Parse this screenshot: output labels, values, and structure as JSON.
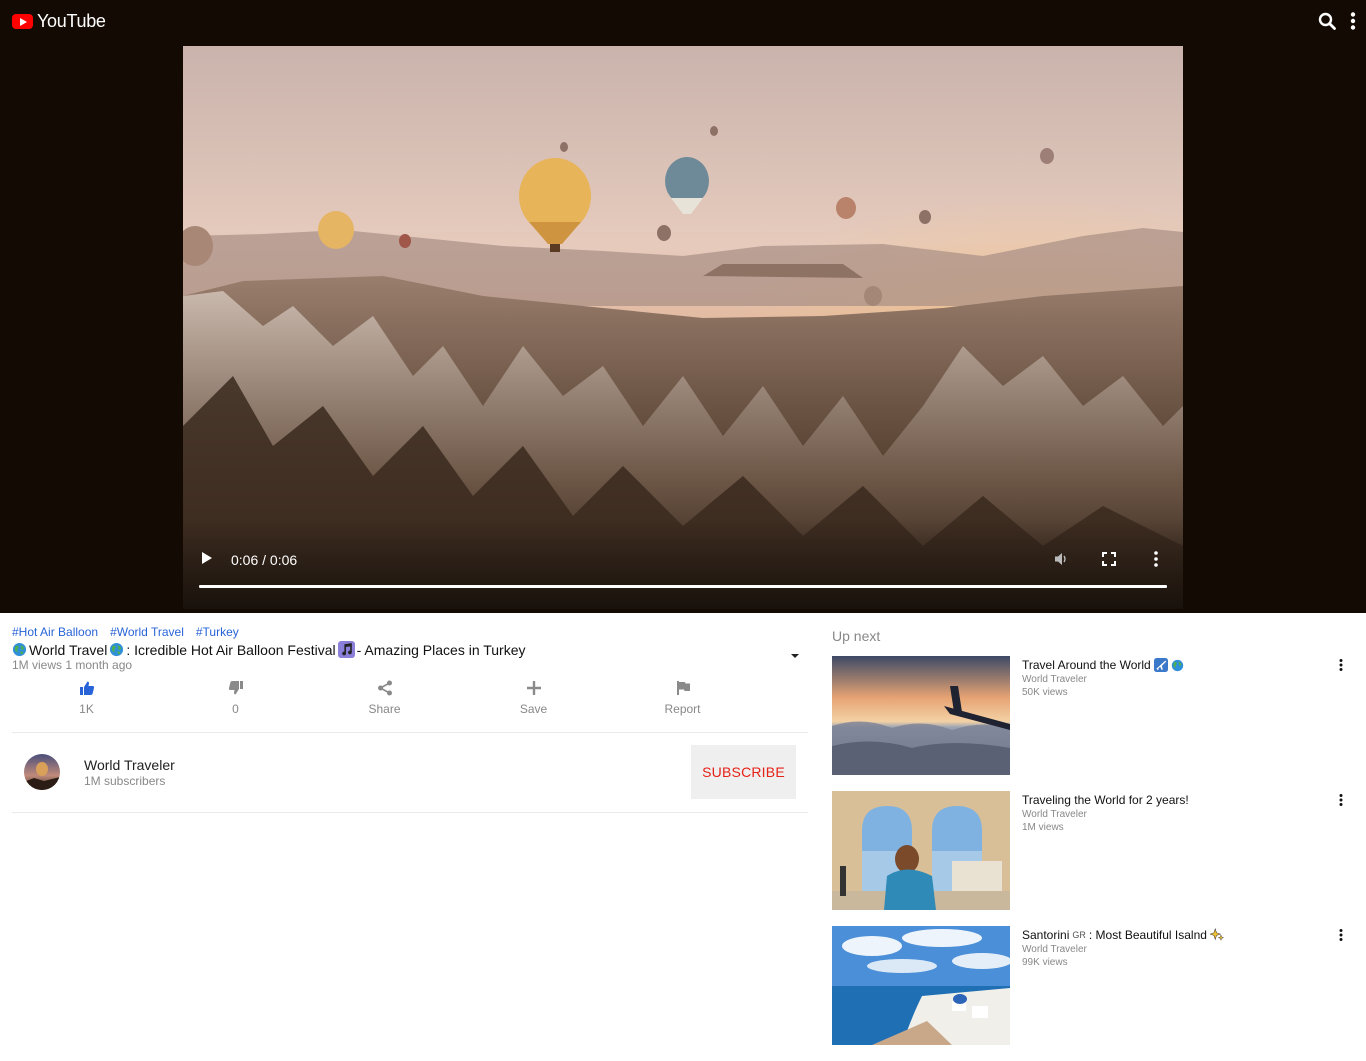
{
  "app": {
    "name": "YouTube"
  },
  "header": {
    "search_icon": "search-icon",
    "menu_icon": "more-vert-icon"
  },
  "player": {
    "time": "0:06 / 0:06",
    "progress": 1.0,
    "controls": [
      "play-icon",
      "volume-icon",
      "fullscreen-icon",
      "more-vert-icon"
    ]
  },
  "video": {
    "tags": [
      "#Hot Air Balloon",
      "#World Travel",
      "#Turkey"
    ],
    "title_part1": "World Travel",
    "title_part2": " : Icredible Hot Air Balloon Festival",
    "title_part3": " - Amazing Places in Turkey",
    "meta": "1M views 1 month ago"
  },
  "actions": [
    {
      "label": "1K",
      "icon": "thumb-up-icon"
    },
    {
      "label": "0",
      "icon": "thumb-down-icon"
    },
    {
      "label": "Share",
      "icon": "share-icon"
    },
    {
      "label": "Save",
      "icon": "add-icon"
    },
    {
      "label": "Report",
      "icon": "flag-icon"
    }
  ],
  "channel": {
    "name": "World Traveler",
    "subscribers": "1M subscribers",
    "subscribe_label": "SUBSCRIBE"
  },
  "up_next": {
    "heading": "Up next",
    "items": [
      {
        "title": "Travel Around the World ",
        "channel": "World Traveler",
        "views": "50K views"
      },
      {
        "title": "Traveling the World for 2 years!",
        "channel": "World Traveler",
        "views": "1M views"
      },
      {
        "title": "Santorini ",
        "title_small": "GR",
        "title_rest": " : Most Beautiful Isalnd",
        "channel": "World Traveler",
        "views": "99K views"
      }
    ]
  },
  "colors": {
    "accent": "#ff0000",
    "link": "#2864d7",
    "like": "#2864d7",
    "subscribe_text": "#e62117",
    "player_bg": "#130b03"
  }
}
